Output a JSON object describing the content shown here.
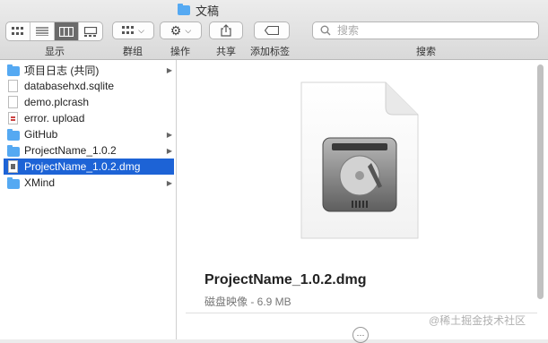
{
  "window": {
    "title": "文稿"
  },
  "toolbar": {
    "view_label": "显示",
    "group_label": "群组",
    "action_label": "操作",
    "share_label": "共享",
    "tag_label": "添加标签",
    "search_label": "搜索",
    "search_placeholder": "搜索",
    "active_view": "column"
  },
  "sidebar": {
    "items": [
      {
        "label": "项目日志 (共同)",
        "icon": "folder-icon",
        "has_children": true,
        "selected": false
      },
      {
        "label": "databasehxd.sqlite",
        "icon": "file-icon",
        "has_children": false,
        "selected": false
      },
      {
        "label": "demo.plcrash",
        "icon": "file-icon",
        "has_children": false,
        "selected": false
      },
      {
        "label": "error. upload",
        "icon": "file-icon",
        "has_children": false,
        "selected": false
      },
      {
        "label": "GitHub",
        "icon": "folder-icon",
        "has_children": true,
        "selected": false
      },
      {
        "label": "ProjectName_1.0.2",
        "icon": "folder-icon",
        "has_children": true,
        "selected": false
      },
      {
        "label": "ProjectName_1.0.2.dmg",
        "icon": "dmg-file-icon",
        "has_children": false,
        "selected": true
      },
      {
        "label": "XMind",
        "icon": "folder-icon",
        "has_children": true,
        "selected": false
      }
    ]
  },
  "preview": {
    "filename": "ProjectName_1.0.2.dmg",
    "meta": "磁盘映像 - 6.9 MB"
  },
  "watermark": "@稀土掘金技术社区",
  "colors": {
    "selection": "#1d63d6",
    "folder": "#55a9f2"
  }
}
